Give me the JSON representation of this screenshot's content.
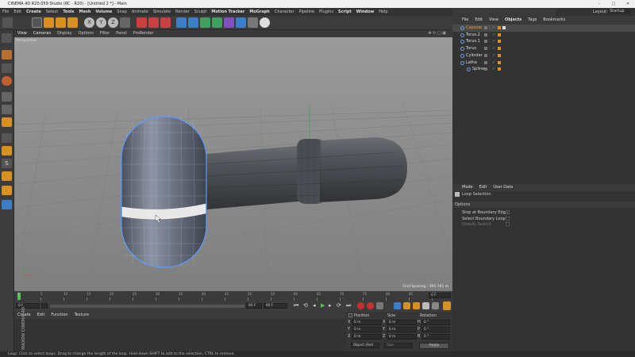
{
  "window": {
    "title": "CINEMA 4D R20.059 Studio (RC - R20) - [Untitled 2 *] - Main"
  },
  "menus": [
    "File",
    "Edit",
    "Create",
    "Select",
    "Tools",
    "Mesh",
    "Volume",
    "Snap",
    "Animate",
    "Simulate",
    "Render",
    "Sculpt",
    "Motion Tracker",
    "MoGraph",
    "Character",
    "Pipeline",
    "Plugins",
    "Script",
    "Window",
    "Help"
  ],
  "layout": {
    "label": "Layout:",
    "value": "Startup"
  },
  "viewport": {
    "menu": [
      "View",
      "Cameras",
      "Display",
      "Options",
      "Filter",
      "Panel",
      "ProRender"
    ],
    "label": "Perspective",
    "grid_spacing": "Grid Spacing : 393.701 m"
  },
  "timeline": {
    "ticks": [
      "0",
      "5",
      "10",
      "15",
      "20",
      "25",
      "30",
      "35",
      "40",
      "45",
      "50",
      "55",
      "60",
      "65",
      "70",
      "75",
      "80",
      "85",
      "90"
    ],
    "end": "0 F"
  },
  "playback": {
    "start": "0 F",
    "current": "0 F",
    "range_end": "90 F",
    "max": "90 F"
  },
  "materials": {
    "menu": [
      "Create",
      "Edit",
      "Function",
      "Texture"
    ],
    "logo": "MAXON CINEMA 4D"
  },
  "coords": {
    "headers": [
      "Position",
      "Size",
      "Rotation"
    ],
    "rows": [
      {
        "axis": "X",
        "pos": "0 m",
        "size_axis": "X",
        "size": "0 m",
        "rot_axis": "H",
        "rot": "0 °"
      },
      {
        "axis": "Y",
        "pos": "0 m",
        "size_axis": "Y",
        "size": "0 m",
        "rot_axis": "P",
        "rot": "0 °"
      },
      {
        "axis": "Z",
        "pos": "0 m",
        "size_axis": "Z",
        "size": "0 m",
        "rot_axis": "B",
        "rot": "0 °"
      }
    ],
    "mode": "Object (Rel)",
    "size_mode": "Size",
    "apply": "Apply"
  },
  "objects": {
    "menu": [
      "File",
      "Edit",
      "View",
      "Objects",
      "Tags",
      "Bookmarks"
    ],
    "items": [
      {
        "name": "Capsule",
        "selected": true,
        "indent": 0
      },
      {
        "name": "Torus.2",
        "selected": false,
        "indent": 0
      },
      {
        "name": "Torus.1",
        "selected": false,
        "indent": 0
      },
      {
        "name": "Torus",
        "selected": false,
        "indent": 0
      },
      {
        "name": "Cylinder",
        "selected": false,
        "indent": 0
      },
      {
        "name": "Lathe",
        "selected": false,
        "indent": 0
      },
      {
        "name": "Spline",
        "selected": false,
        "indent": 1
      }
    ]
  },
  "attributes": {
    "menu": [
      "Mode",
      "Edit",
      "User Data"
    ],
    "tool": "Loop Selection",
    "section": "Options",
    "options": [
      {
        "label": "Stop at Boundary Edges",
        "checked": true
      },
      {
        "label": "Select Boundary Loop",
        "checked": false
      },
      {
        "label": "Greedy Search",
        "checked": false
      }
    ]
  },
  "status": "Loop: Click to select loops. Drag to change the length of the loop. Hold down SHIFT to add to the selection, CTRL to remove."
}
